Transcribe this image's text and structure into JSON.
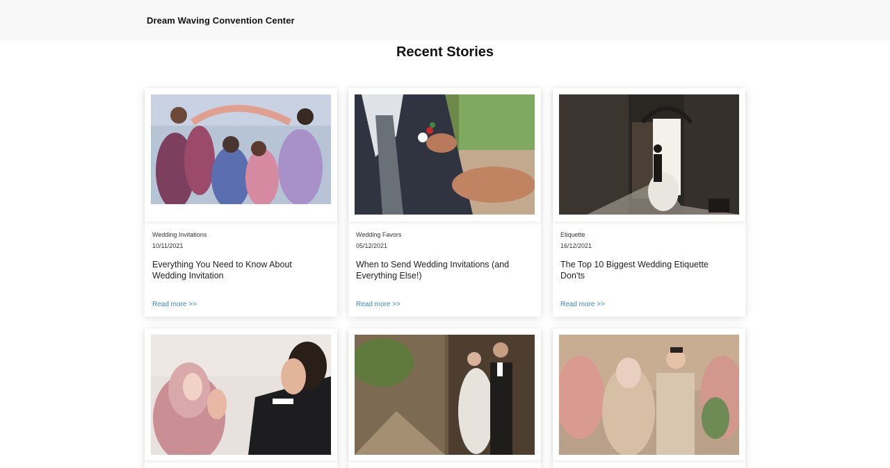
{
  "header": {
    "brand": "Dream Waving Convention Center"
  },
  "main": {
    "title": "Recent Stories",
    "read_more_label": "Read more >>",
    "stories": [
      {
        "category": "Wedding Invitations",
        "date": "10/11/2021",
        "title": "Everything You Need to Know About Wedding Invitation"
      },
      {
        "category": "Wedding Favors",
        "date": "05/12/2021",
        "title": "When to Send Wedding Invitations (and Everything Else!)"
      },
      {
        "category": "Etiquette",
        "date": "16/12/2021",
        "title": "The Top 10 Biggest Wedding Etiquette Don'ts"
      }
    ]
  }
}
